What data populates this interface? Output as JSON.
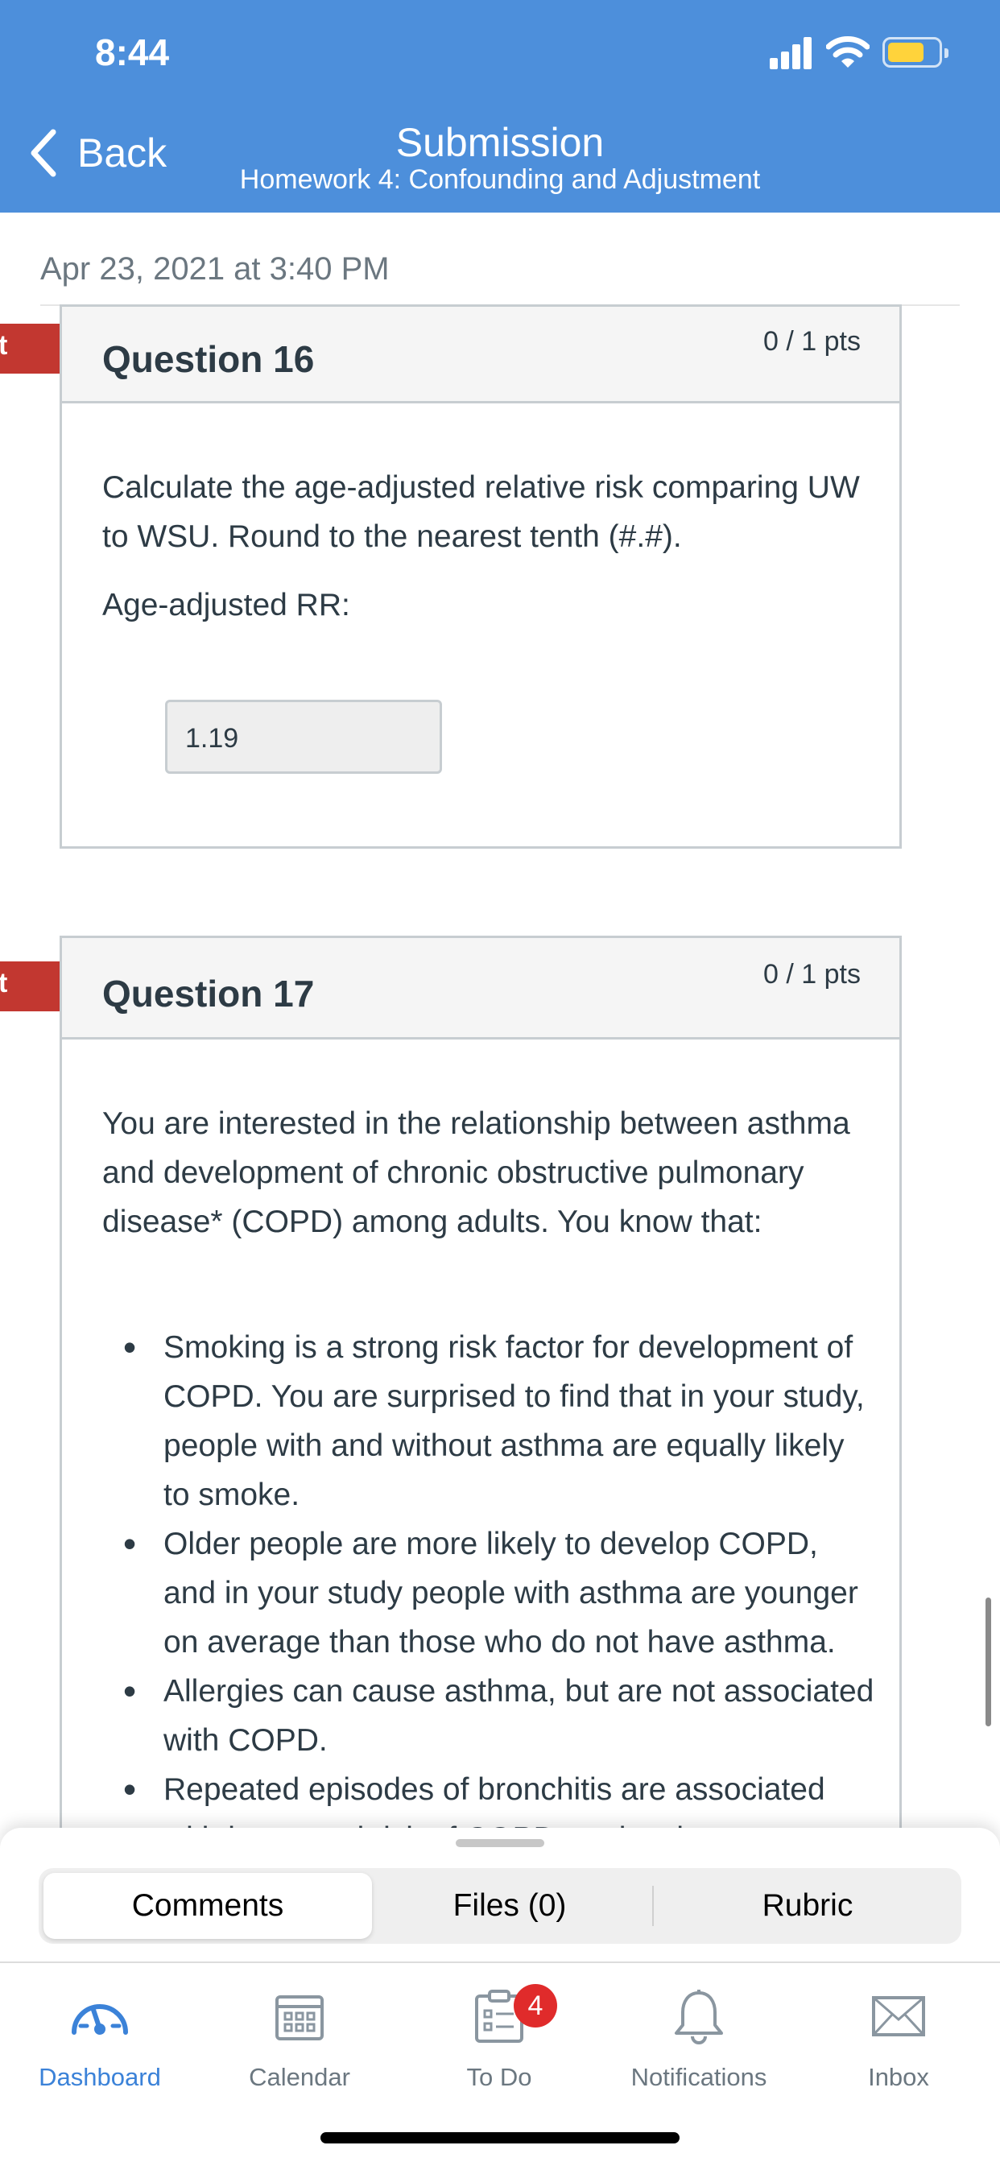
{
  "status_bar": {
    "time": "8:44"
  },
  "nav": {
    "back_label": "Back",
    "title": "Submission",
    "subtitle": "Homework 4: Confounding and Adjustment"
  },
  "submission_date": "Apr 23, 2021 at 3:40 PM",
  "questions": [
    {
      "flag_text": "t",
      "title": "Question 16",
      "points": "0 / 1 pts",
      "prompt": "Calculate the age-adjusted relative risk comparing UW to WSU. Round to the nearest tenth (#.#).",
      "answer_label": "Age-adjusted RR:",
      "answer_value": "1.19"
    },
    {
      "flag_text": "t",
      "title": "Question 17",
      "points": "0 / 1 pts",
      "prompt": "You are interested in the relationship between asthma and development of chronic obstructive pulmonary disease* (COPD) among adults. You know that:",
      "bullets": [
        "Smoking is a strong risk factor for development of COPD. You are surprised to find that in your study, people with and without asthma are equally likely to smoke.",
        "Older people are more likely to develop COPD, and in your study people with asthma are younger on average than those who do not have asthma.",
        "Allergies can cause asthma, but are not associated with COPD.",
        "Repeated episodes of bronchitis are associated with increased risk of COPD, and asthma causes"
      ]
    }
  ],
  "bottom_tabs": {
    "comments": "Comments",
    "files": "Files (0)",
    "rubric": "Rubric"
  },
  "tab_bar": {
    "dashboard": "Dashboard",
    "calendar": "Calendar",
    "todo": "To Do",
    "todo_badge": "4",
    "notifications": "Notifications",
    "inbox": "Inbox"
  },
  "colors": {
    "nav_blue": "#4d8fdb",
    "flag_red": "#c23730",
    "active_tab": "#3b82d8",
    "badge_red": "#e02b2b"
  }
}
